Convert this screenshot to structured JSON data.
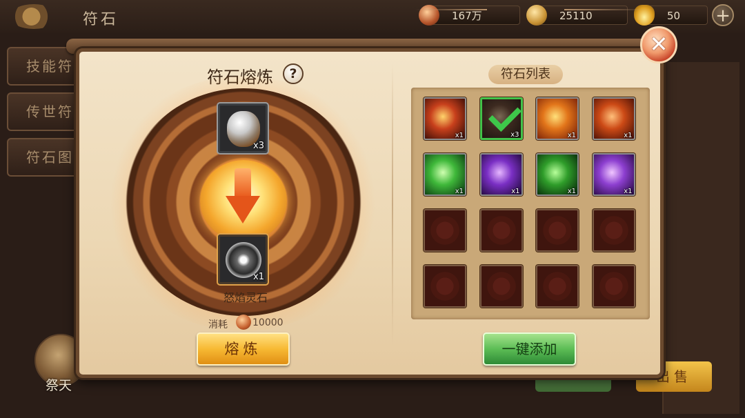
{
  "header": {
    "title": "符石",
    "copper": "167万",
    "gold": "25110",
    "ingot": "50",
    "plus_label": "+"
  },
  "side_tabs": [
    {
      "label": "技能符"
    },
    {
      "label": "传世符"
    },
    {
      "label": "符石图"
    }
  ],
  "altar": {
    "label": "祭天"
  },
  "background_buttons": {
    "sell": "出售"
  },
  "dialog": {
    "close_label": "✕",
    "smelt": {
      "title": "符石熔炼",
      "help": "?",
      "input_count": "x3",
      "output_count": "x1",
      "output_name": "怒焰灵石",
      "cost_label": "消耗",
      "cost_value": "10000",
      "button": "熔炼"
    },
    "rune_list": {
      "title": "符石列表",
      "add_all_button": "一键添加",
      "runes": [
        {
          "icon": "explosion-rune-icon",
          "count": "x1",
          "selected": false,
          "colors": [
            "#ffd36b",
            "#c8401c",
            "#3a0d06"
          ]
        },
        {
          "icon": "spiked-stone-rune-icon",
          "count": "x3",
          "selected": true,
          "colors": [
            "#7b6a55",
            "#3d2a20",
            "#1c1410"
          ]
        },
        {
          "icon": "flame-tornado-rune-icon",
          "count": "x1",
          "selected": false,
          "colors": [
            "#ffe07a",
            "#e2751a",
            "#7a2108"
          ]
        },
        {
          "icon": "fire-slash-rune-icon",
          "count": "x1",
          "selected": false,
          "colors": [
            "#ffbf7a",
            "#cc4a16",
            "#4a1006"
          ]
        },
        {
          "icon": "green-sphere-rune-icon",
          "count": "x1",
          "selected": false,
          "colors": [
            "#cfffb0",
            "#3fb83a",
            "#0d3c12"
          ]
        },
        {
          "icon": "purple-demon-rune-icon",
          "count": "x1",
          "selected": false,
          "colors": [
            "#e6b7ff",
            "#7a2fc4",
            "#220a3c"
          ]
        },
        {
          "icon": "green-constellation-rune-icon",
          "count": "x1",
          "selected": false,
          "colors": [
            "#b7ff9a",
            "#2f9d2a",
            "#082a0a"
          ]
        },
        {
          "icon": "purple-skull-rune-icon",
          "count": "x1",
          "selected": false,
          "colors": [
            "#f0c6ff",
            "#8d3fd0",
            "#2a0b46"
          ]
        },
        {
          "icon": "empty-slot-icon",
          "count": "",
          "selected": false,
          "empty": true
        },
        {
          "icon": "empty-slot-icon",
          "count": "",
          "selected": false,
          "empty": true
        },
        {
          "icon": "empty-slot-icon",
          "count": "",
          "selected": false,
          "empty": true
        },
        {
          "icon": "empty-slot-icon",
          "count": "",
          "selected": false,
          "empty": true
        },
        {
          "icon": "empty-slot-icon",
          "count": "",
          "selected": false,
          "empty": true
        },
        {
          "icon": "empty-slot-icon",
          "count": "",
          "selected": false,
          "empty": true
        },
        {
          "icon": "empty-slot-icon",
          "count": "",
          "selected": false,
          "empty": true
        },
        {
          "icon": "empty-slot-icon",
          "count": "",
          "selected": false,
          "empty": true
        }
      ]
    }
  }
}
